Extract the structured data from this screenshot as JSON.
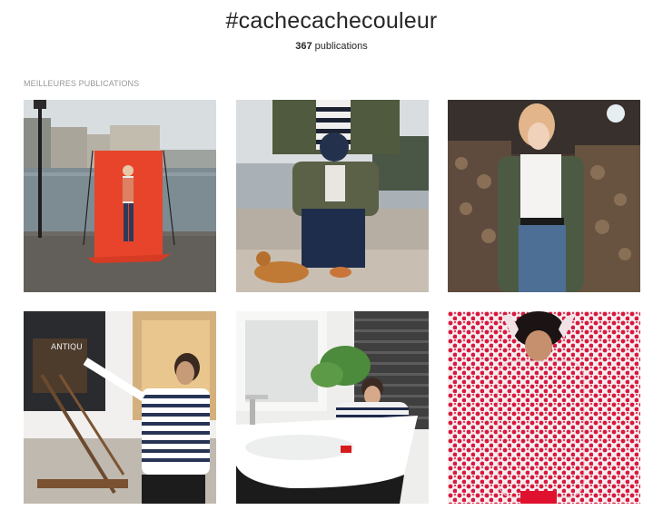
{
  "header": {
    "hashtag": "#cachecachecouleur",
    "count": "367",
    "count_label": "publications"
  },
  "section": {
    "label": "MEILLEURES PUBLICATIONS"
  },
  "posts": [
    {
      "subject": "woman-red-backdrop-seine"
    },
    {
      "subject": "child-parent-striped-shirt"
    },
    {
      "subject": "woman-khaki-parka"
    },
    {
      "subject": "man-painting-easel"
    },
    {
      "subject": "woman-bathtub-striped"
    },
    {
      "subject": "child-red-heart-pattern"
    }
  ],
  "visual_text": {
    "shop_sign": "ANTIQU"
  },
  "colors": {
    "text": "#262626",
    "muted": "#999999",
    "backdrop_red": "#e8442b",
    "heart_red": "#d8183e"
  }
}
